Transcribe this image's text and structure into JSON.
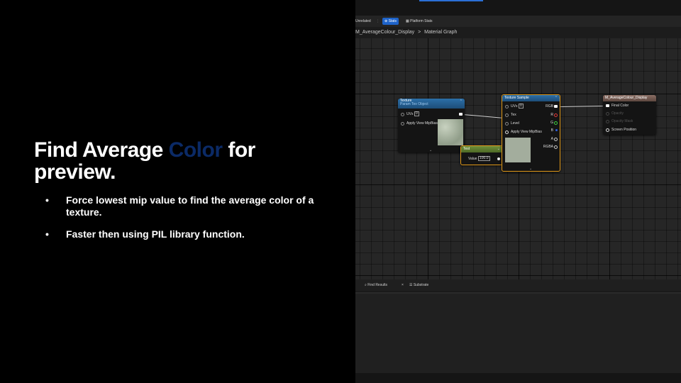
{
  "slide": {
    "title_pre": "Find Average ",
    "title_accent": "Color",
    "title_post": " for preview.",
    "bullets": [
      "Force lowest mip value to find the average color of a texture.",
      "Faster then using PIL library function."
    ],
    "bullet_symbol": "•",
    "accent_color": "#0b2a66"
  },
  "editor": {
    "toolbar": {
      "unrelated": "Unrelated",
      "stats": "Stats",
      "platform_stats": "Platform Stats"
    },
    "breadcrumb": {
      "asset": "M_AverageColour_Display",
      "separator": ">",
      "graph": "Material Graph"
    },
    "nodes": {
      "texture_param": {
        "title": "Texture",
        "subtitle": "Param Tex Object",
        "pins": [
          "UVs",
          "Apply View MipBias"
        ],
        "uvs_value": "0"
      },
      "texture_sample": {
        "title": "Texture Sample",
        "inputs": [
          "UVs",
          "Tex",
          "Level",
          "Apply View MipBias"
        ],
        "uvs_value": "0",
        "outputs": [
          "RGB",
          "R",
          "G",
          "B",
          "A",
          "RGBA"
        ]
      },
      "scalar": {
        "title": "Test",
        "label": "Value",
        "value": "100.0"
      },
      "result": {
        "title": "M_AverageColour_Display",
        "pins": [
          "Final Color",
          "Opacity",
          "Opacity Mask",
          "Screen Position"
        ]
      }
    },
    "bottom_tabs": {
      "find_results": "Find Results",
      "close": "×",
      "substrate": "Substrate"
    }
  }
}
